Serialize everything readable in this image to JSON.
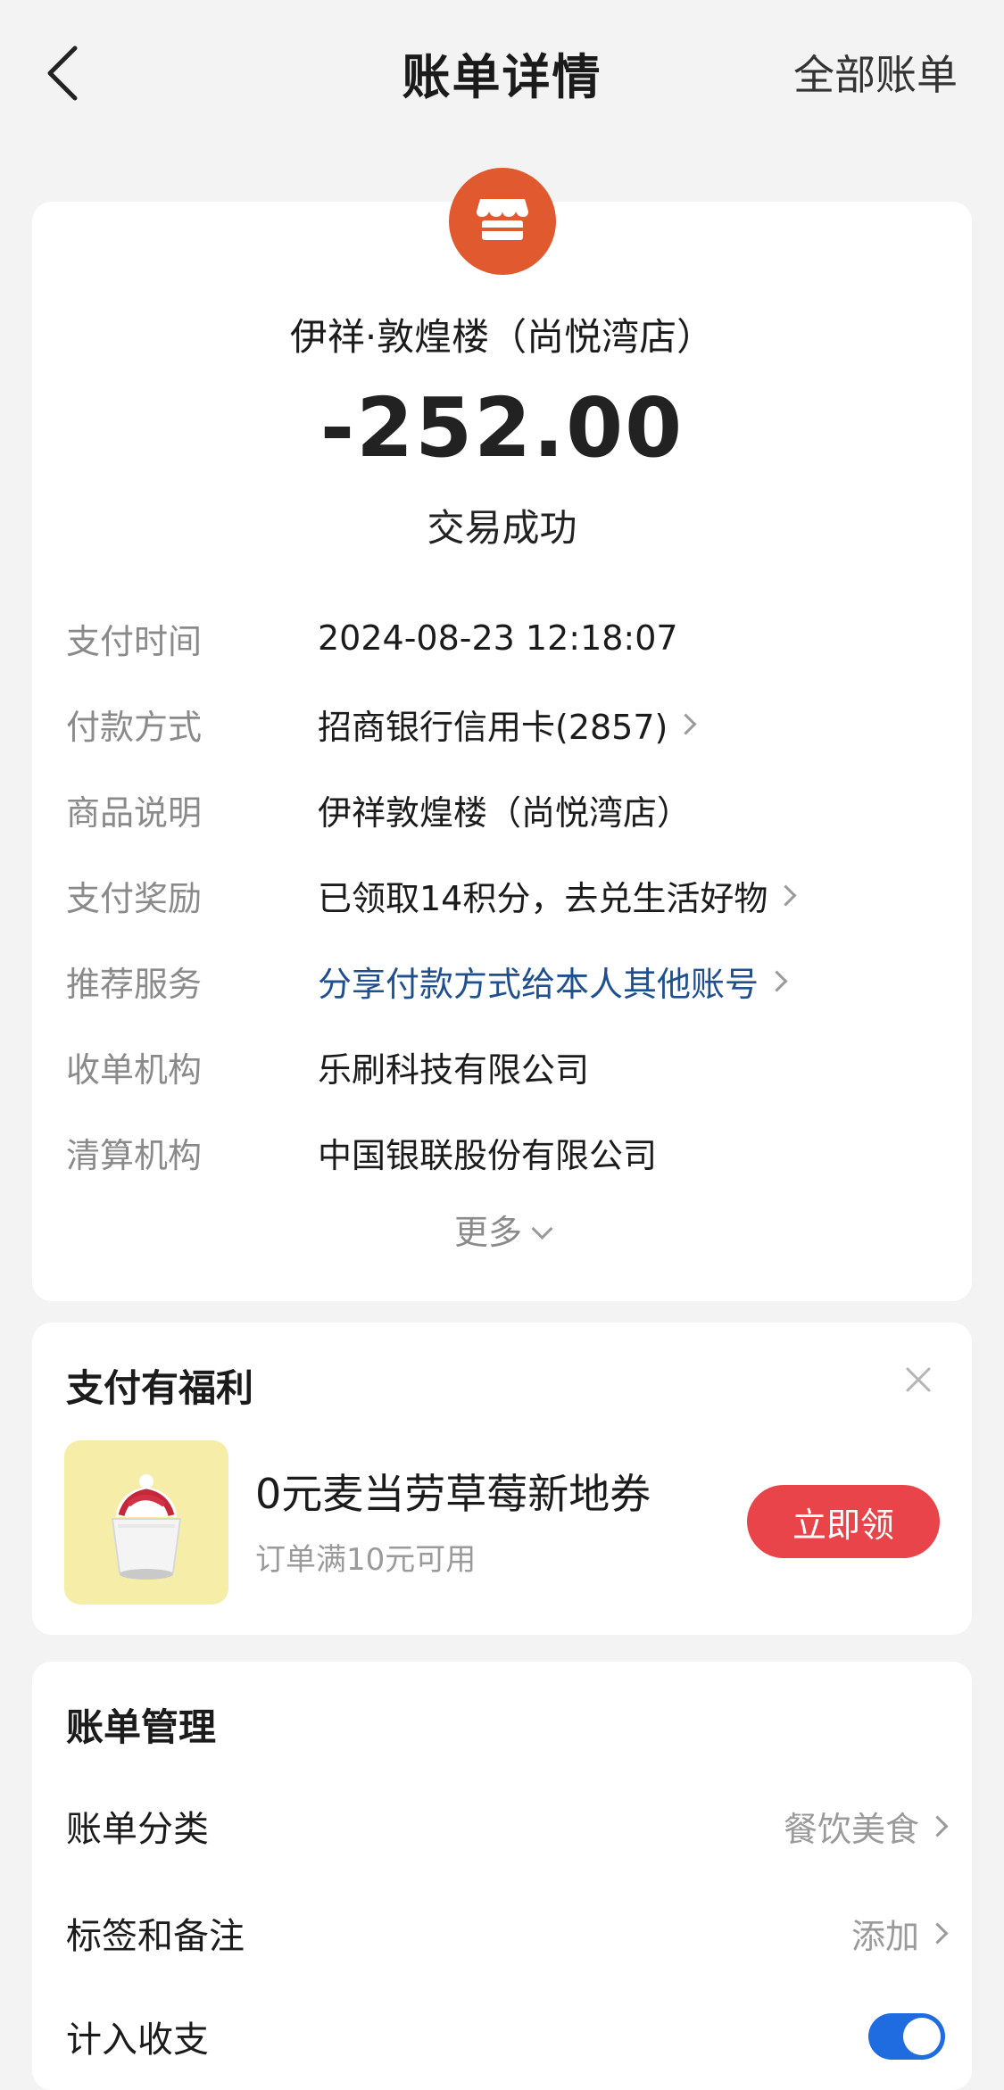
{
  "nav": {
    "back_icon": "chevron-left-icon",
    "title": "账单详情",
    "right_label": "全部账单"
  },
  "merchant": {
    "icon": "store-icon",
    "icon_color": "#e1592f",
    "name": "伊祥·敦煌楼（尚悦湾店）",
    "amount": "-252.00",
    "status": "交易成功"
  },
  "details": [
    {
      "label": "支付时间",
      "value": "2024-08-23 12:18:07"
    },
    {
      "label": "付款方式",
      "value": "招商银行信用卡(2857)"
    },
    {
      "label": "商品说明",
      "value": "伊祥敦煌楼（尚悦湾店）"
    },
    {
      "label": "支付奖励",
      "value": "已领取14积分，去兑生活好物"
    },
    {
      "label": "推荐服务",
      "value": "分享付款方式给本人其他账号"
    },
    {
      "label": "收单机构",
      "value": "乐刷科技有限公司"
    },
    {
      "label": "清算机构",
      "value": "中国银联股份有限公司"
    }
  ],
  "more_label": "更多",
  "benefit": {
    "title": "支付有福利",
    "close_icon": "close-icon",
    "coupon_image": "strawberry-sundae-image",
    "coupon_title": "0元麦当劳草莓新地券",
    "coupon_subtitle": "订单满10元可用",
    "claim_label": "立即领",
    "claim_color": "#e84449"
  },
  "manage": {
    "title": "账单管理",
    "category_label": "账单分类",
    "category_value": "餐饮美食",
    "tag_label": "标签和备注",
    "tag_value": "添加",
    "include_label": "计入收支",
    "include_on": true,
    "toggle_color": "#1f6ce0"
  },
  "colors": {
    "link": "#1f4f8f",
    "background": "#f3f3f3"
  }
}
